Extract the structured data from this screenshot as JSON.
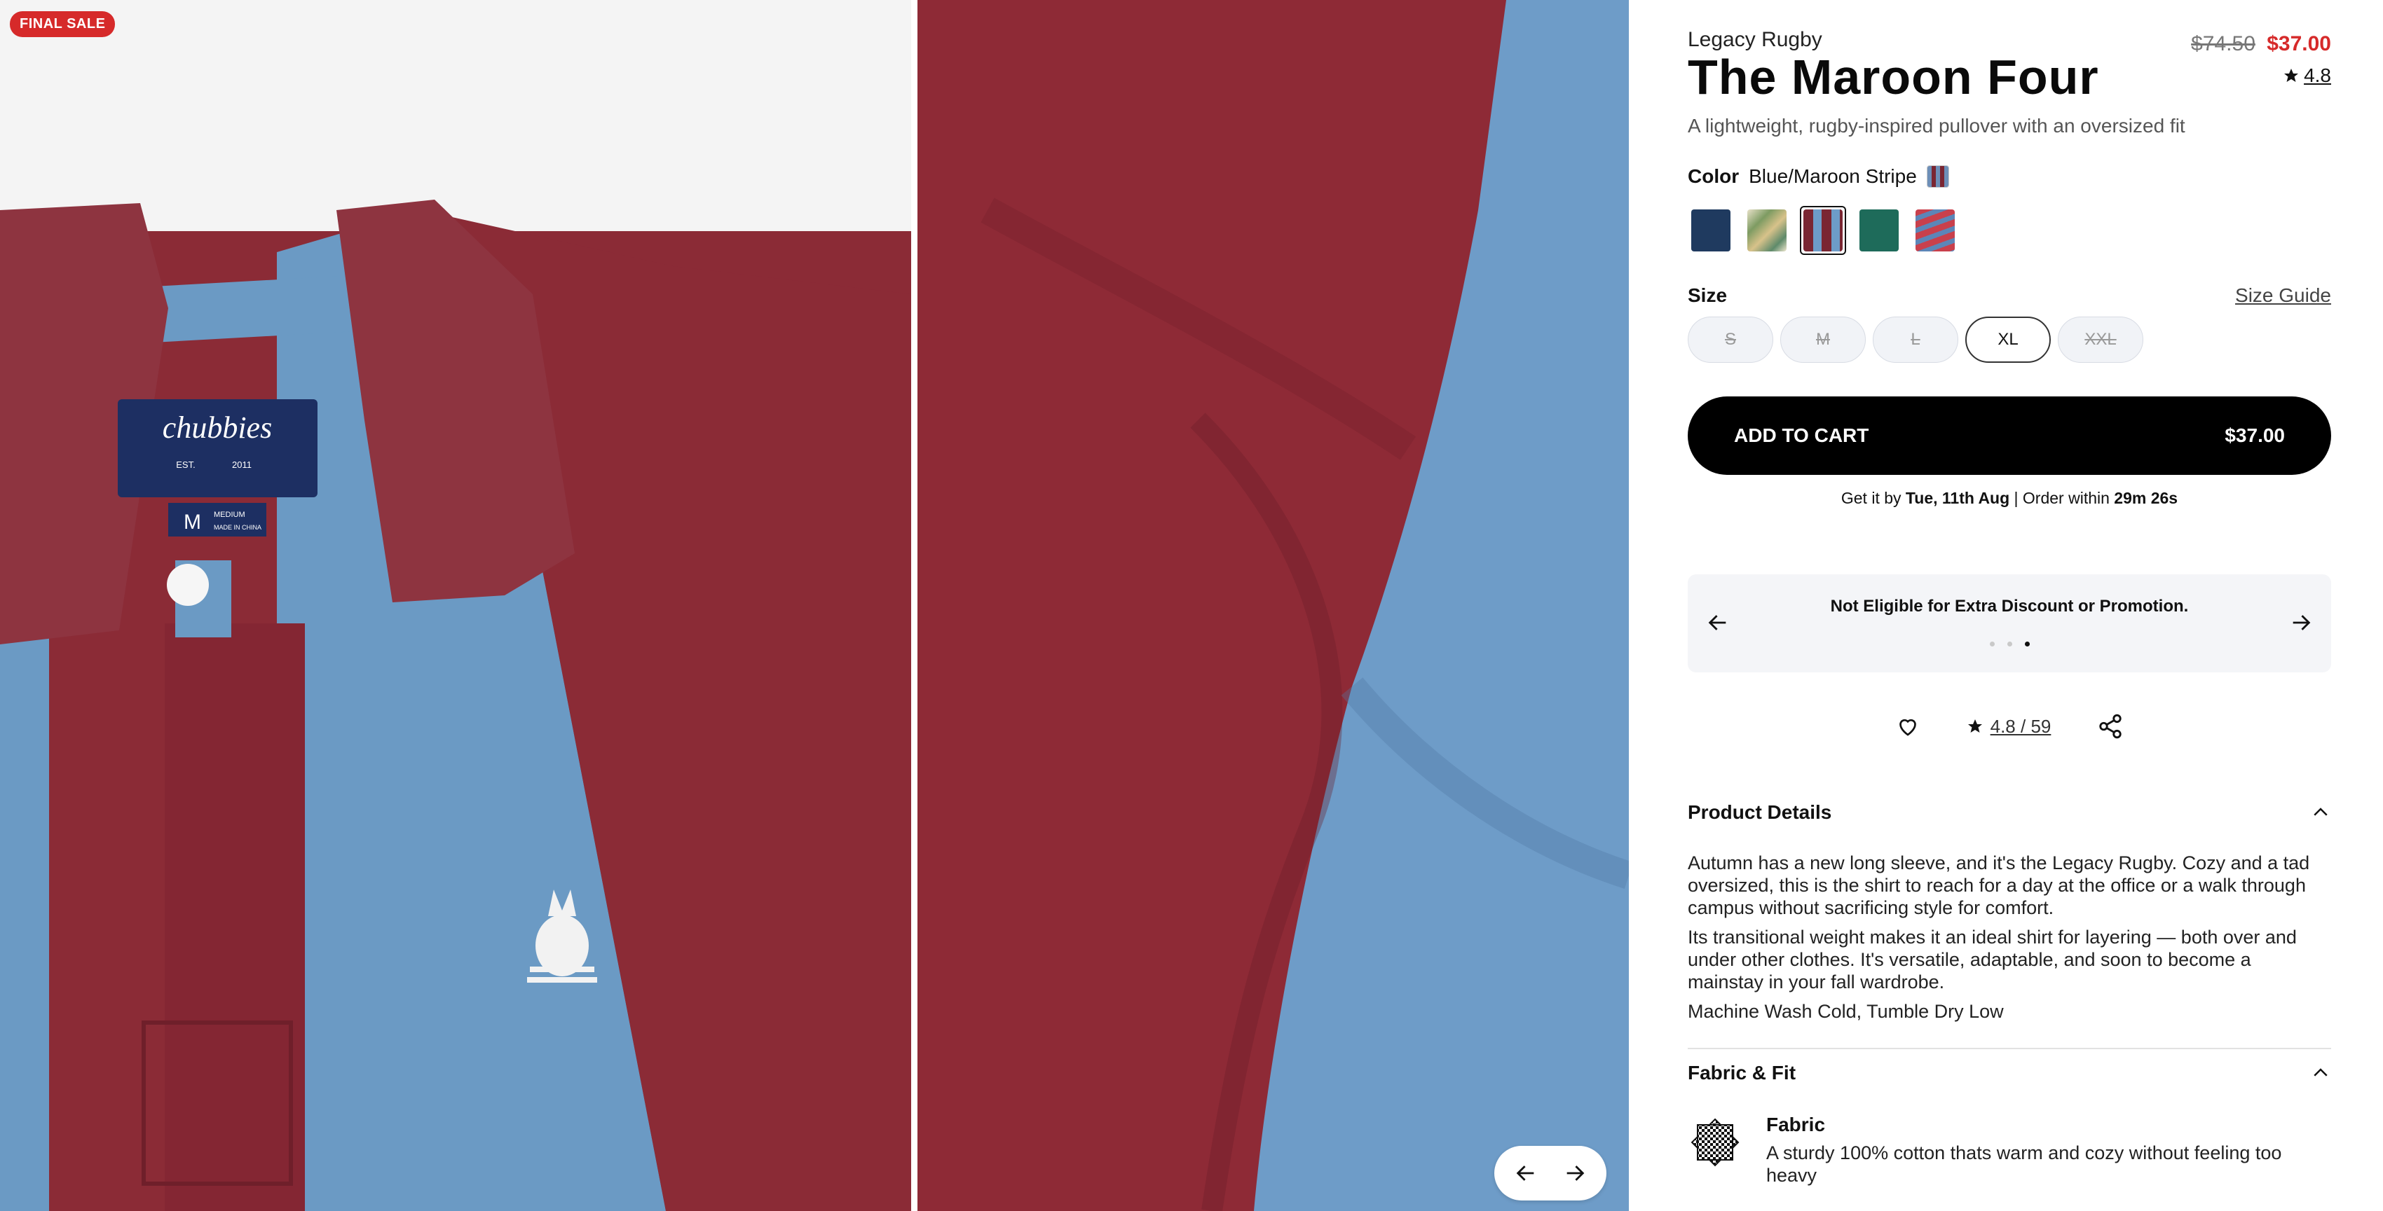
{
  "gallery": {
    "badge": "FINAL SALE",
    "label_brand": "chubbies",
    "label_est": "EST.",
    "label_year": "2011",
    "label_size": "M",
    "label_size_word": "MEDIUM",
    "label_origin": "MADE IN CHINA",
    "prev_icon": "arrow-left-icon",
    "next_icon": "arrow-right-icon"
  },
  "product": {
    "brand_line": "Legacy Rugby",
    "title": "The Maroon Four",
    "price_old": "$74.50",
    "price_new": "$37.00",
    "rating": "4.8",
    "subtitle": "A lightweight, rugby-inspired pullover with an oversized fit"
  },
  "color": {
    "label": "Color",
    "selected_name": "Blue/Maroon Stripe",
    "swatches": [
      {
        "name": "navy",
        "color": "#1f3a5f"
      },
      {
        "name": "tropical-print",
        "color": "#c9d3a8"
      },
      {
        "name": "blue-maroon-stripe",
        "color": "#7a2632",
        "selected": true
      },
      {
        "name": "green",
        "color": "#1e6b5a"
      },
      {
        "name": "red-blue-stripe",
        "color": "#c9404c"
      }
    ]
  },
  "size": {
    "label": "Size",
    "guide_label": "Size Guide",
    "options": [
      {
        "label": "S",
        "available": false
      },
      {
        "label": "M",
        "available": false
      },
      {
        "label": "L",
        "available": false
      },
      {
        "label": "XL",
        "available": true
      },
      {
        "label": "XXL",
        "available": false
      }
    ]
  },
  "cart": {
    "button_label": "ADD TO CART",
    "button_price": "$37.00",
    "delivery_prefix": "Get it by",
    "delivery_date": "Tue, 11th Aug",
    "delivery_sep": " | Order within ",
    "delivery_countdown": "29m 26s"
  },
  "promo": {
    "text": "Not Eligible for Extra Discount or Promotion.",
    "slide_count": 3,
    "active_slide": 3
  },
  "actions": {
    "rating_text": "4.8 / 59"
  },
  "details": {
    "title": "Product Details",
    "paragraph1": "Autumn has a new long sleeve, and it's the Legacy Rugby. Cozy and a tad oversized, this is the shirt to reach for a day at the office or a walk through campus without sacrificing style for comfort.",
    "paragraph2": "Its transitional weight makes it an ideal shirt for layering — both over and under other clothes. It's versatile, adaptable, and soon to become a mainstay in your fall wardrobe.",
    "care": "Machine Wash Cold, Tumble Dry Low"
  },
  "fabric_fit": {
    "title": "Fabric & Fit",
    "fabric_title": "Fabric",
    "fabric_text": "A sturdy 100% cotton thats warm and cozy without feeling too heavy"
  },
  "colors": {
    "maroon": "#8e2a36",
    "blue": "#6d9cc6",
    "sale_red": "#d62a2a",
    "black": "#000000"
  }
}
